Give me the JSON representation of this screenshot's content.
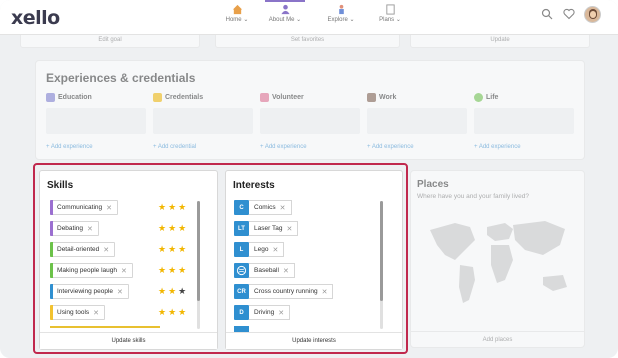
{
  "app": {
    "logo": "xello"
  },
  "nav": {
    "items": [
      {
        "label": "Home",
        "icon": "home-icon"
      },
      {
        "label": "About Me",
        "icon": "person-icon"
      },
      {
        "label": "Explore",
        "icon": "explore-person-icon"
      },
      {
        "label": "Plans",
        "icon": "plans-icon"
      }
    ],
    "active": "About Me"
  },
  "top_cards": [
    "Edit goal",
    "Set favorites",
    "Update"
  ],
  "experiences": {
    "title": "Experiences & credentials",
    "columns": [
      {
        "label": "Education",
        "action": "+ Add experience",
        "color": "#7b7bd0"
      },
      {
        "label": "Credentials",
        "action": "+ Add credential",
        "color": "#f2b600"
      },
      {
        "label": "Volunteer",
        "action": "+ Add experience",
        "color": "#e06a8f"
      },
      {
        "label": "Work",
        "action": "+ Add experience",
        "color": "#7a5a4a"
      },
      {
        "label": "Life",
        "action": "+ Add experience",
        "color": "#6cc24a"
      }
    ]
  },
  "skills": {
    "title": "Skills",
    "footer": "Update skills",
    "items": [
      {
        "label": "Communicating",
        "color": "#9b6fd0",
        "stars": 3
      },
      {
        "label": "Debating",
        "color": "#9b6fd0",
        "stars": 3
      },
      {
        "label": "Detail-oriented",
        "color": "#6cc24a",
        "stars": 3
      },
      {
        "label": "Making people laugh",
        "color": "#6cc24a",
        "stars": 3
      },
      {
        "label": "Interviewing people",
        "color": "#2f8fd0",
        "stars": 2
      },
      {
        "label": "Using tools",
        "color": "#f2c230",
        "stars": 3
      }
    ]
  },
  "interests": {
    "title": "Interests",
    "footer": "Update interests",
    "items": [
      {
        "badge": "C",
        "label": "Comics"
      },
      {
        "badge": "LT",
        "label": "Laser Tag"
      },
      {
        "badge": "L",
        "label": "Lego"
      },
      {
        "badge": "",
        "label": "Baseball"
      },
      {
        "badge": "CR",
        "label": "Cross country running"
      },
      {
        "badge": "D",
        "label": "Driving"
      }
    ],
    "badge_color": "#2f8fd0"
  },
  "places": {
    "title": "Places",
    "subtitle": "Where have you and your family lived?",
    "footer": "Add places"
  },
  "colors": {
    "highlight": "#c0284d",
    "star": "#f2b600",
    "brand": "#3b3b4f"
  }
}
